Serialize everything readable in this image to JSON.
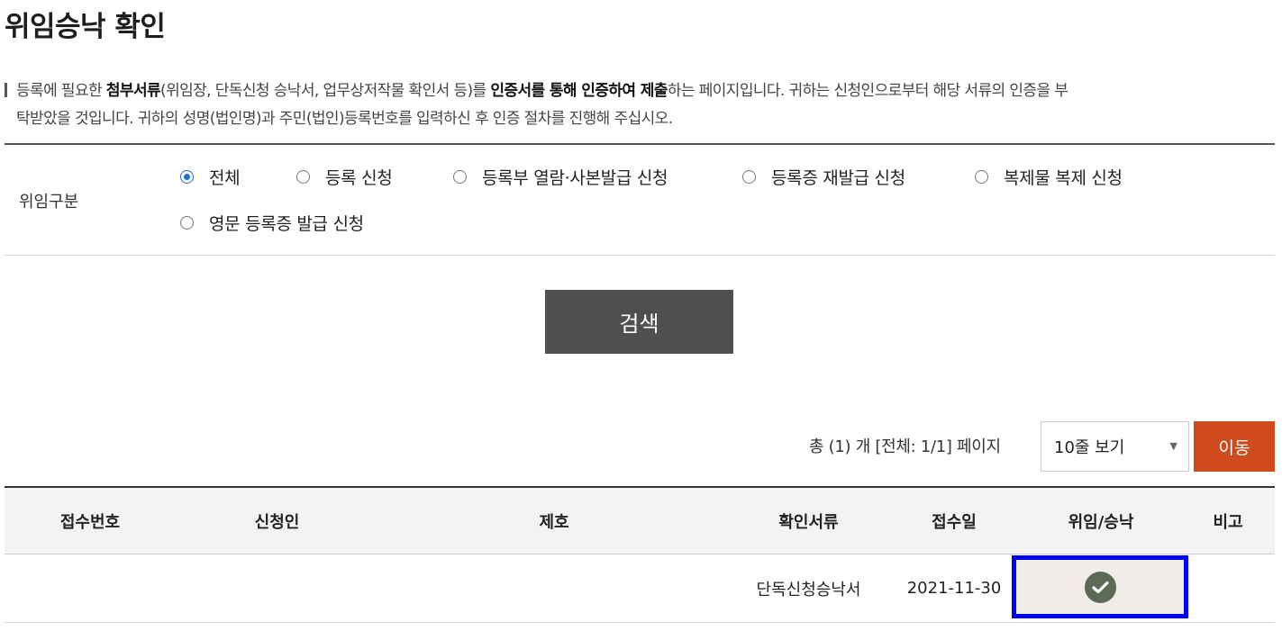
{
  "page": {
    "title": "위임승낙 확인"
  },
  "notice": {
    "part1": "등록에 필요한 ",
    "bold1": "첨부서류",
    "part2": "(위임장, 단독신청 승낙서, 업무상저작물 확인서 등)를 ",
    "bold2": "인증서를 통해 인증하여 제출",
    "part3": "하는 페이지입니다. 귀하는 신청인으로부터 해당 서류의 인증을 부",
    "line2": "탁받았을 것입니다. 귀하의 성명(법인명)과 주민(법인)등록번호를 입력하신 후 인증 절차를 진행해 주십시오."
  },
  "filter": {
    "label": "위임구분",
    "selected": "전체",
    "options": [
      {
        "label": "전체",
        "selected": true
      },
      {
        "label": "등록 신청",
        "selected": false
      },
      {
        "label": "등록부 열람·사본발급 신청",
        "selected": false
      },
      {
        "label": "등록증 재발급 신청",
        "selected": false
      },
      {
        "label": "복제물 복제 신청",
        "selected": false
      },
      {
        "label": "영문 등록증 발급 신청",
        "selected": false
      }
    ]
  },
  "search": {
    "button_label": "검색"
  },
  "pagination": {
    "info": "총 (1) 개 [전체: 1/1] 페이지",
    "rows_select_value": "10줄 보기",
    "go_button_label": "이동"
  },
  "table": {
    "columns": [
      "접수번호",
      "신청인",
      "제호",
      "확인서류",
      "접수일",
      "위임/승낙",
      "비고"
    ],
    "rows": [
      {
        "receipt_no": "",
        "applicant": "",
        "title": "",
        "document": "단독신청승낙서",
        "date": "2021-11-30",
        "status": "check-icon",
        "note": ""
      }
    ]
  },
  "colors": {
    "accent_radio": "#1e6fd0",
    "search_button": "#4f4f4f",
    "go_button": "#cf4a1d",
    "check_icon": "#5b6a55",
    "highlight_border": "#0000ff"
  }
}
